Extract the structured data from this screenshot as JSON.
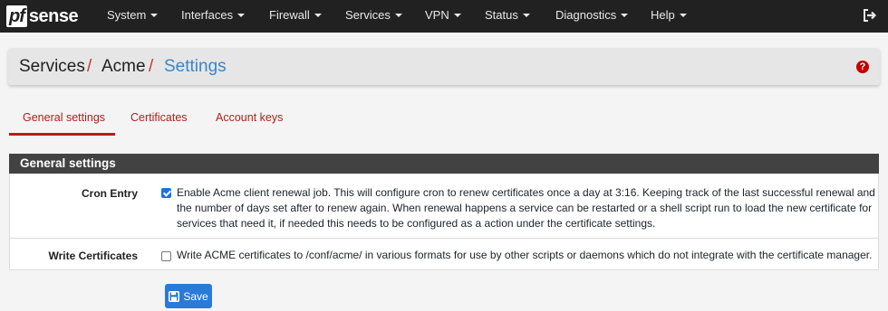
{
  "brand": {
    "logo_pf": "pf",
    "logo_sense": "sense"
  },
  "nav": {
    "items": [
      {
        "label": "System"
      },
      {
        "label": "Interfaces"
      },
      {
        "label": "Firewall"
      },
      {
        "label": "Services"
      },
      {
        "label": "VPN"
      },
      {
        "label": "Status"
      },
      {
        "label": "Diagnostics"
      },
      {
        "label": "Help"
      }
    ],
    "logout_icon": "sign-out-icon"
  },
  "breadcrumb": {
    "items": [
      "Services",
      "Acme",
      "Settings"
    ],
    "separator": "/",
    "help_icon": "question-circle-icon",
    "help_glyph": "?"
  },
  "tabs": [
    {
      "label": "General settings",
      "active": true
    },
    {
      "label": "Certificates",
      "active": false
    },
    {
      "label": "Account keys",
      "active": false
    }
  ],
  "panel": {
    "title": "General settings",
    "rows": [
      {
        "label": "Cron Entry",
        "checked": true,
        "lines": [
          "Enable Acme client renewal job. This will configure cron to renew certificates once a day at 3:16. Keeping track of the last successful renewal and",
          "the number of days set after to renew again. When renewal happens a service can be restarted or a shell script run to load the new certificate for",
          "services that need it, if needed this needs to be configured as a action under the certificate settings."
        ]
      },
      {
        "label": "Write Certificates",
        "checked": false,
        "lines": [
          "Write ACME certificates to /conf/acme/ in various formats for use by other scripts or daemons which do not integrate with the certificate manager."
        ]
      }
    ]
  },
  "save_button": {
    "label": "Save",
    "icon": "save-icon"
  },
  "colors": {
    "navbar": "#212121",
    "accent_red": "#b71c1c",
    "link_blue": "#3a86c8",
    "button_blue": "#2a7ad8",
    "panel_header": "#424242"
  }
}
